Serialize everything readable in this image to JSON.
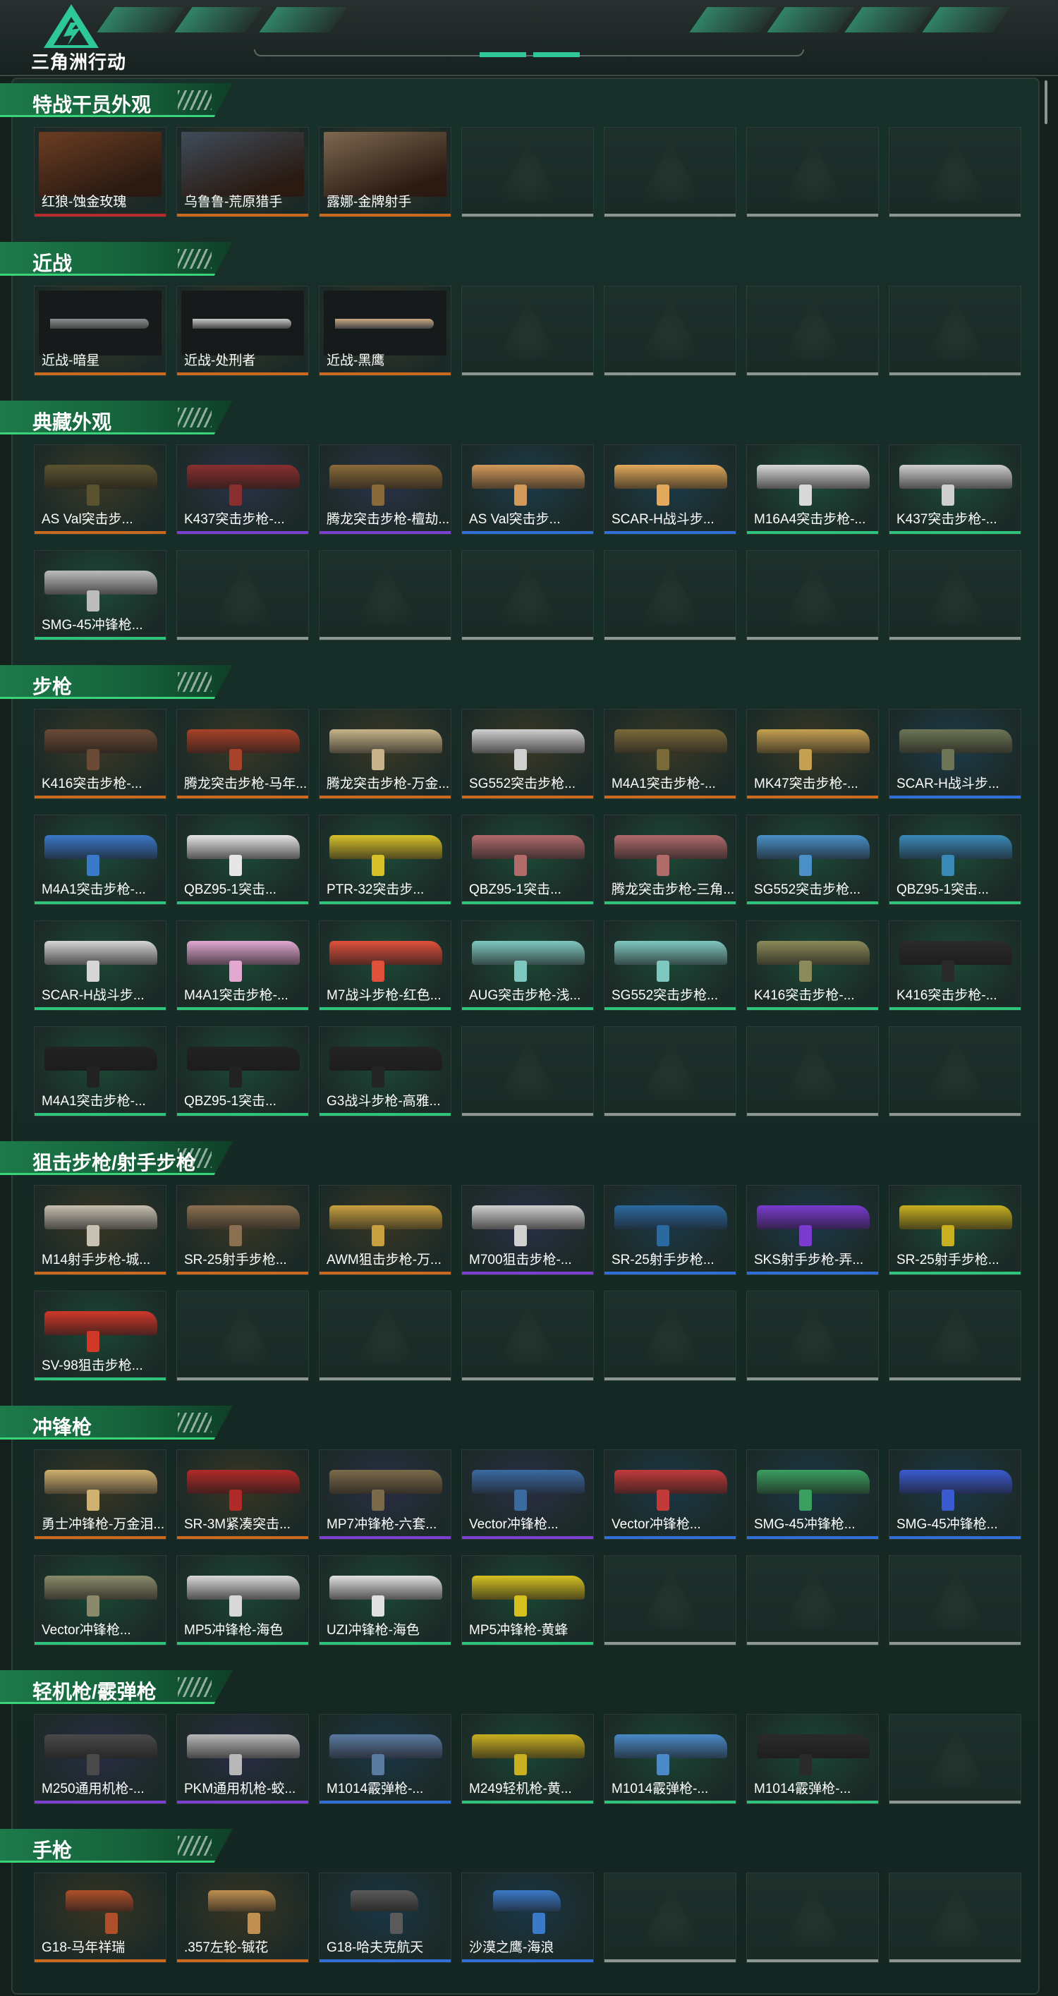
{
  "header": {
    "logo_text": "三角洲行动"
  },
  "colors": {
    "gold": "#d6862a",
    "orange": "#c96a1f",
    "red": "#b52a2a",
    "purple": "#7b3fd1",
    "blue": "#2f6fd8",
    "green": "#2ec47c",
    "empty": "#8c9792"
  },
  "sections": [
    {
      "title": "特战干员外观",
      "kind": "portrait",
      "cols": 7,
      "items": [
        {
          "label": "红狼-蚀金玫瑰",
          "rarity": "red",
          "tint": "#6b3d22"
        },
        {
          "label": "乌鲁鲁-荒原猎手",
          "rarity": "orange",
          "tint": "#3f4c5a"
        },
        {
          "label": "露娜-金牌射手",
          "rarity": "orange",
          "tint": "#7d6850"
        }
      ],
      "slots": 7
    },
    {
      "title": "近战",
      "kind": "knife",
      "cols": 7,
      "items": [
        {
          "label": "近战-暗星",
          "rarity": "orange",
          "tint": "#8a8e8f"
        },
        {
          "label": "近战-处刑者",
          "rarity": "orange",
          "tint": "#c6c8c8"
        },
        {
          "label": "近战-黑鹰",
          "rarity": "orange",
          "tint": "#c9a882"
        }
      ],
      "slots": 7
    },
    {
      "title": "典藏外观",
      "kind": "gun",
      "cols": 7,
      "items": [
        {
          "label": "AS Val突击步...",
          "rarity": "orange",
          "tint": "#5b5330"
        },
        {
          "label": "K437突击步枪-...",
          "rarity": "purple",
          "tint": "#8a2f2f"
        },
        {
          "label": "腾龙突击步枪-檀劫...",
          "rarity": "purple",
          "tint": "#8a6a3a"
        },
        {
          "label": "AS Val突击步...",
          "rarity": "blue",
          "tint": "#d29a5a"
        },
        {
          "label": "SCAR-H战斗步...",
          "rarity": "blue",
          "tint": "#e2a95a"
        },
        {
          "label": "M16A4突击步枪-...",
          "rarity": "green",
          "tint": "#d8d8d8"
        },
        {
          "label": "K437突击步枪-...",
          "rarity": "green",
          "tint": "#cfcfcf"
        },
        {
          "label": "SMG-45冲锋枪...",
          "rarity": "green",
          "tint": "#bcbcbc"
        }
      ],
      "slots": 14
    },
    {
      "title": "步枪",
      "kind": "gun",
      "cols": 7,
      "items": [
        {
          "label": "K416突击步枪-...",
          "rarity": "orange",
          "tint": "#6a4a35"
        },
        {
          "label": "腾龙突击步枪-马年...",
          "rarity": "orange",
          "tint": "#a8422a"
        },
        {
          "label": "腾龙突击步枪-万金...",
          "rarity": "orange",
          "tint": "#c8b48a"
        },
        {
          "label": "SG552突击步枪...",
          "rarity": "orange",
          "tint": "#d0d0d0"
        },
        {
          "label": "M4A1突击步枪-...",
          "rarity": "orange",
          "tint": "#7a6a3a"
        },
        {
          "label": "MK47突击步枪-...",
          "rarity": "orange",
          "tint": "#c4a050"
        },
        {
          "label": "SCAR-H战斗步...",
          "rarity": "blue",
          "tint": "#6d7556"
        },
        {
          "label": "M4A1突击步枪-...",
          "rarity": "green",
          "tint": "#3a78c8"
        },
        {
          "label": "QBZ95-1突击...",
          "rarity": "green",
          "tint": "#e6e6e6"
        },
        {
          "label": "PTR-32突击步...",
          "rarity": "green",
          "tint": "#d6c12a"
        },
        {
          "label": "QBZ95-1突击...",
          "rarity": "green",
          "tint": "#b06b6b"
        },
        {
          "label": "腾龙突击步枪-三角...",
          "rarity": "green",
          "tint": "#b06b6b"
        },
        {
          "label": "SG552突击步枪...",
          "rarity": "green",
          "tint": "#4a8fc8"
        },
        {
          "label": "QBZ95-1突击...",
          "rarity": "green",
          "tint": "#3a8ab8"
        },
        {
          "label": "SCAR-H战斗步...",
          "rarity": "green",
          "tint": "#d6d6d6"
        },
        {
          "label": "M4A1突击步枪-...",
          "rarity": "green",
          "tint": "#e2a8d2"
        },
        {
          "label": "M7战斗步枪-红色...",
          "rarity": "green",
          "tint": "#e0503a"
        },
        {
          "label": "AUG突击步枪-浅...",
          "rarity": "green",
          "tint": "#7fc8c0"
        },
        {
          "label": "SG552突击步枪...",
          "rarity": "green",
          "tint": "#7fc8c0"
        },
        {
          "label": "K416突击步枪-...",
          "rarity": "green",
          "tint": "#8a8a5a"
        },
        {
          "label": "K416突击步枪-...",
          "rarity": "green",
          "tint": "#2a2a2a"
        },
        {
          "label": "M4A1突击步枪-...",
          "rarity": "green",
          "tint": "#222222"
        },
        {
          "label": "QBZ95-1突击...",
          "rarity": "green",
          "tint": "#222222"
        },
        {
          "label": "G3战斗步枪-高雅...",
          "rarity": "green",
          "tint": "#242424"
        }
      ],
      "slots": 28
    },
    {
      "title": "狙击步枪/射手步枪",
      "kind": "gun",
      "cols": 7,
      "items": [
        {
          "label": "M14射手步枪-城...",
          "rarity": "orange",
          "tint": "#c8c0b0"
        },
        {
          "label": "SR-25射手步枪...",
          "rarity": "orange",
          "tint": "#8a7050"
        },
        {
          "label": "AWM狙击步枪-万...",
          "rarity": "orange",
          "tint": "#c8a040"
        },
        {
          "label": "M700狙击步枪-...",
          "rarity": "purple",
          "tint": "#d0d0d0"
        },
        {
          "label": "SR-25射手步枪...",
          "rarity": "blue",
          "tint": "#2a6aa0"
        },
        {
          "label": "SKS射手步枪-弄...",
          "rarity": "blue",
          "tint": "#7a3ad0"
        },
        {
          "label": "SR-25射手步枪...",
          "rarity": "green",
          "tint": "#c8b020"
        },
        {
          "label": "SV-98狙击步枪...",
          "rarity": "green",
          "tint": "#d0382a"
        }
      ],
      "slots": 14
    },
    {
      "title": "冲锋枪",
      "kind": "gun",
      "cols": 7,
      "items": [
        {
          "label": "勇士冲锋枪-万金泪...",
          "rarity": "orange",
          "tint": "#d0b070"
        },
        {
          "label": "SR-3M紧凑突击...",
          "rarity": "orange",
          "tint": "#b02a2a"
        },
        {
          "label": "MP7冲锋枪-六套...",
          "rarity": "purple",
          "tint": "#7a6a4a"
        },
        {
          "label": "Vector冲锋枪...",
          "rarity": "purple",
          "tint": "#3a6aa0"
        },
        {
          "label": "Vector冲锋枪...",
          "rarity": "blue",
          "tint": "#c03a3a"
        },
        {
          "label": "SMG-45冲锋枪...",
          "rarity": "blue",
          "tint": "#3aa060"
        },
        {
          "label": "SMG-45冲锋枪...",
          "rarity": "blue",
          "tint": "#3a5ad0"
        },
        {
          "label": "Vector冲锋枪...",
          "rarity": "green",
          "tint": "#8a8a6a"
        },
        {
          "label": "MP5冲锋枪-海色",
          "rarity": "green",
          "tint": "#d8d8d8"
        },
        {
          "label": "UZI冲锋枪-海色",
          "rarity": "green",
          "tint": "#e0e0e0"
        },
        {
          "label": "MP5冲锋枪-黄蜂",
          "rarity": "green",
          "tint": "#d6c020"
        }
      ],
      "slots": 14
    },
    {
      "title": "轻机枪/霰弹枪",
      "kind": "gun",
      "cols": 7,
      "items": [
        {
          "label": "M250通用机枪-...",
          "rarity": "purple",
          "tint": "#4a4a4a"
        },
        {
          "label": "PKM通用机枪-蛟...",
          "rarity": "purple",
          "tint": "#b8b8b8"
        },
        {
          "label": "M1014霰弹枪-...",
          "rarity": "blue",
          "tint": "#5a7aa0"
        },
        {
          "label": "M249轻机枪-黄...",
          "rarity": "green",
          "tint": "#c8b020"
        },
        {
          "label": "M1014霰弹枪-...",
          "rarity": "green",
          "tint": "#4a8ac8"
        },
        {
          "label": "M1014霰弹枪-...",
          "rarity": "green",
          "tint": "#2a2a2a"
        }
      ],
      "slots": 7
    },
    {
      "title": "手枪",
      "kind": "pistol",
      "cols": 7,
      "items": [
        {
          "label": "G18-马年祥瑞",
          "rarity": "orange",
          "tint": "#b0502a"
        },
        {
          "label": ".357左轮-铖花",
          "rarity": "orange",
          "tint": "#c09050"
        },
        {
          "label": "G18-哈夫克航天",
          "rarity": "blue",
          "tint": "#5a5a5a"
        },
        {
          "label": "沙漠之鹰-海浪",
          "rarity": "blue",
          "tint": "#3a7ac8"
        }
      ],
      "slots": 7
    }
  ]
}
